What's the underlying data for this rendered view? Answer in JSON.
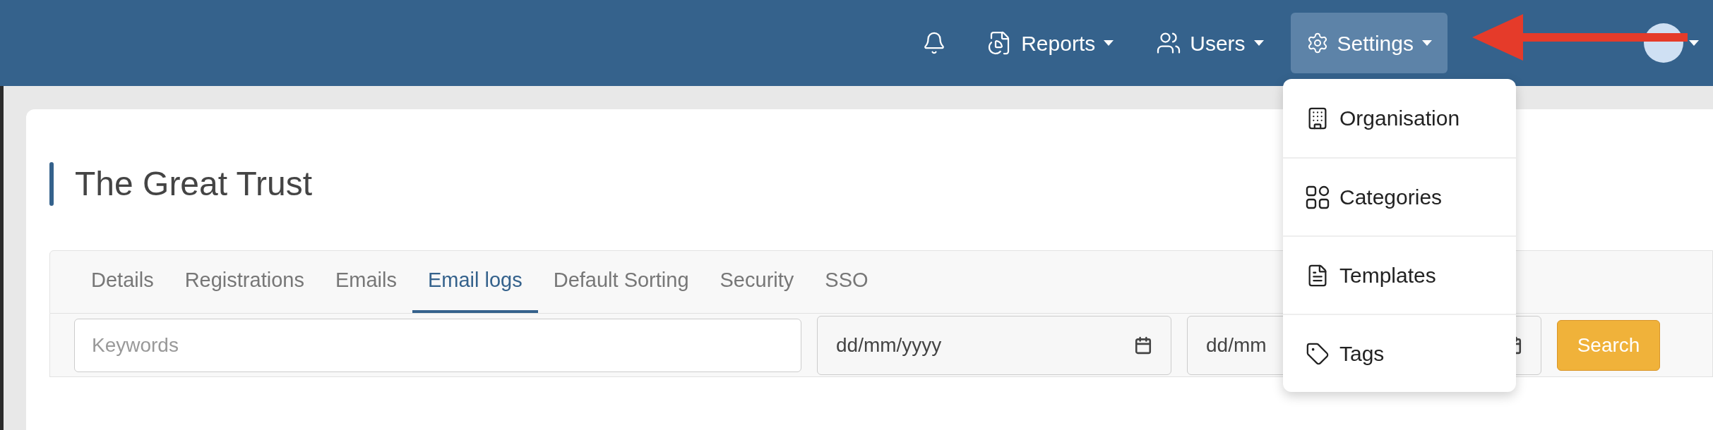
{
  "nav": {
    "menus": [
      {
        "label": "Reports",
        "selected": false
      },
      {
        "label": "Users",
        "selected": false
      },
      {
        "label": "Settings",
        "selected": true
      }
    ]
  },
  "dropdown": {
    "items": [
      {
        "label": "Organisation"
      },
      {
        "label": "Categories"
      },
      {
        "label": "Templates"
      },
      {
        "label": "Tags"
      }
    ]
  },
  "page": {
    "title": "The Great Trust"
  },
  "tabs": [
    {
      "label": "Details",
      "selected": false
    },
    {
      "label": "Registrations",
      "selected": false
    },
    {
      "label": "Emails",
      "selected": false
    },
    {
      "label": "Email logs",
      "selected": true
    },
    {
      "label": "Default Sorting",
      "selected": false
    },
    {
      "label": "Security",
      "selected": false
    },
    {
      "label": "SSO",
      "selected": false
    }
  ],
  "filters": {
    "keywords": {
      "placeholder": "Keywords"
    },
    "date_from": {
      "placeholder": "dd/mm/yyyy"
    },
    "date_to": {
      "placeholder": "dd/mm"
    },
    "search_button": "Search"
  }
}
